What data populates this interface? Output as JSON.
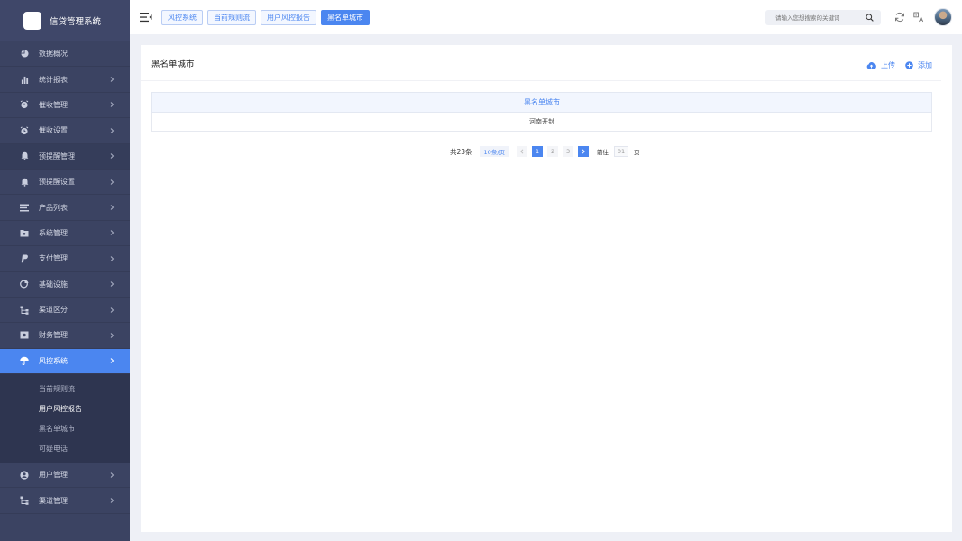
{
  "app": {
    "title": "信贷管理系统"
  },
  "sidebar": {
    "items": [
      {
        "label": "数据概况",
        "icon": "pie-chart-icon",
        "chevron": false
      },
      {
        "label": "统计报表",
        "icon": "bar-chart-icon",
        "chevron": true
      },
      {
        "label": "催收管理",
        "icon": "alarm-clock-icon",
        "chevron": true
      },
      {
        "label": "催收设置",
        "icon": "alarm-clock-icon",
        "chevron": true
      },
      {
        "label": "预提醒管理",
        "icon": "bell-icon",
        "chevron": true
      },
      {
        "label": "预提醒设置",
        "icon": "bell-icon",
        "chevron": true
      },
      {
        "label": "产品列表",
        "icon": "list-icon",
        "chevron": true
      },
      {
        "label": "系统管理",
        "icon": "folder-gear-icon",
        "chevron": true
      },
      {
        "label": "支付管理",
        "icon": "paypal-icon",
        "chevron": true
      },
      {
        "label": "基础设施",
        "icon": "pie-segment-icon",
        "chevron": true
      },
      {
        "label": "渠道区分",
        "icon": "hierarchy-icon",
        "chevron": true
      },
      {
        "label": "财务管理",
        "icon": "money-icon",
        "chevron": true
      },
      {
        "label": "风控系统",
        "icon": "umbrella-icon",
        "chevron": true,
        "active": true
      },
      {
        "label": "用户管理",
        "icon": "user-icon",
        "chevron": true
      },
      {
        "label": "渠道管理",
        "icon": "hierarchy-icon",
        "chevron": true
      }
    ],
    "submenu": [
      "当前规则流",
      "用户风控报告",
      "黑名单城市",
      "可疑电话"
    ]
  },
  "topbar": {
    "tabs": [
      "风控系统",
      "当前规则流",
      "用户风控报告",
      "黑名单城市"
    ],
    "active_tab": 3,
    "search_placeholder": "请输入您想搜索的关键词"
  },
  "content": {
    "title": "黑名单城市",
    "upload_label": "上传",
    "add_label": "添加",
    "table": {
      "columns": [
        "黑名单城市"
      ],
      "rows": [
        [
          "河南开封"
        ]
      ]
    },
    "pagination": {
      "total": "共23条",
      "page_size": "10条/页",
      "pages": [
        "1",
        "2",
        "3"
      ],
      "current_page": "1",
      "goto_label": "前往",
      "goto_value": "01",
      "unit": "页"
    }
  },
  "colors": {
    "accent": "#4b86f0",
    "sidebar_bg": "#3b4362",
    "page_bg": "#eef0f6"
  }
}
